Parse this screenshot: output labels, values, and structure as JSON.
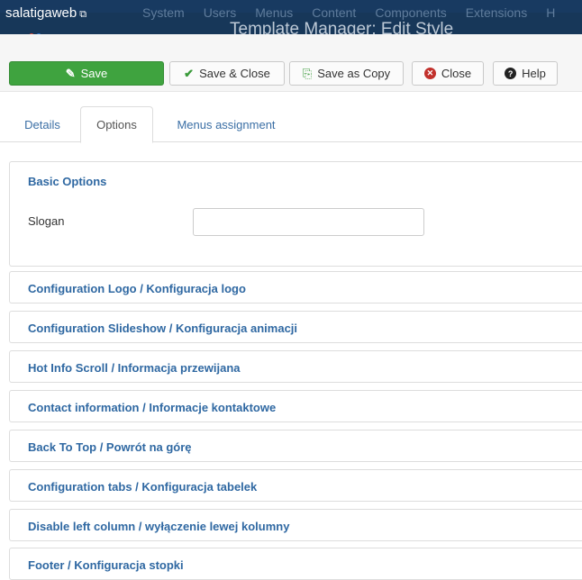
{
  "topbar": {
    "brand": "salatigaweb",
    "brand_ext": "⧉",
    "menu": [
      "System",
      "Users",
      "Menus",
      "Content",
      "Components",
      "Extensions",
      "H"
    ],
    "page_title": "Template Manager: Edit Style"
  },
  "toolbar": {
    "save": "Save",
    "save_close": "Save & Close",
    "save_copy": "Save as Copy",
    "close": "Close",
    "help": "Help"
  },
  "tabs": [
    "Details",
    "Options",
    "Menus assignment"
  ],
  "basic_options": {
    "title": "Basic Options",
    "slogan_label": "Slogan",
    "slogan_value": ""
  },
  "accordion": [
    "Configuration Logo / Konfiguracja logo",
    "Configuration Slideshow / Konfiguracja animacji",
    "Hot Info Scroll / Informacja przewijana",
    "Contact information / Informacje kontaktowe",
    "Back To Top / Powrót na górę",
    "Configuration tabs / Konfiguracja tabelek",
    "Disable left column / wyłączenie lewej kolumny",
    "Footer / Konfiguracja stopki"
  ],
  "colors": {
    "topbar": "#183a61",
    "save_green": "#3fa33f",
    "link_blue": "#2f68a2",
    "close_red": "#c2312c"
  }
}
